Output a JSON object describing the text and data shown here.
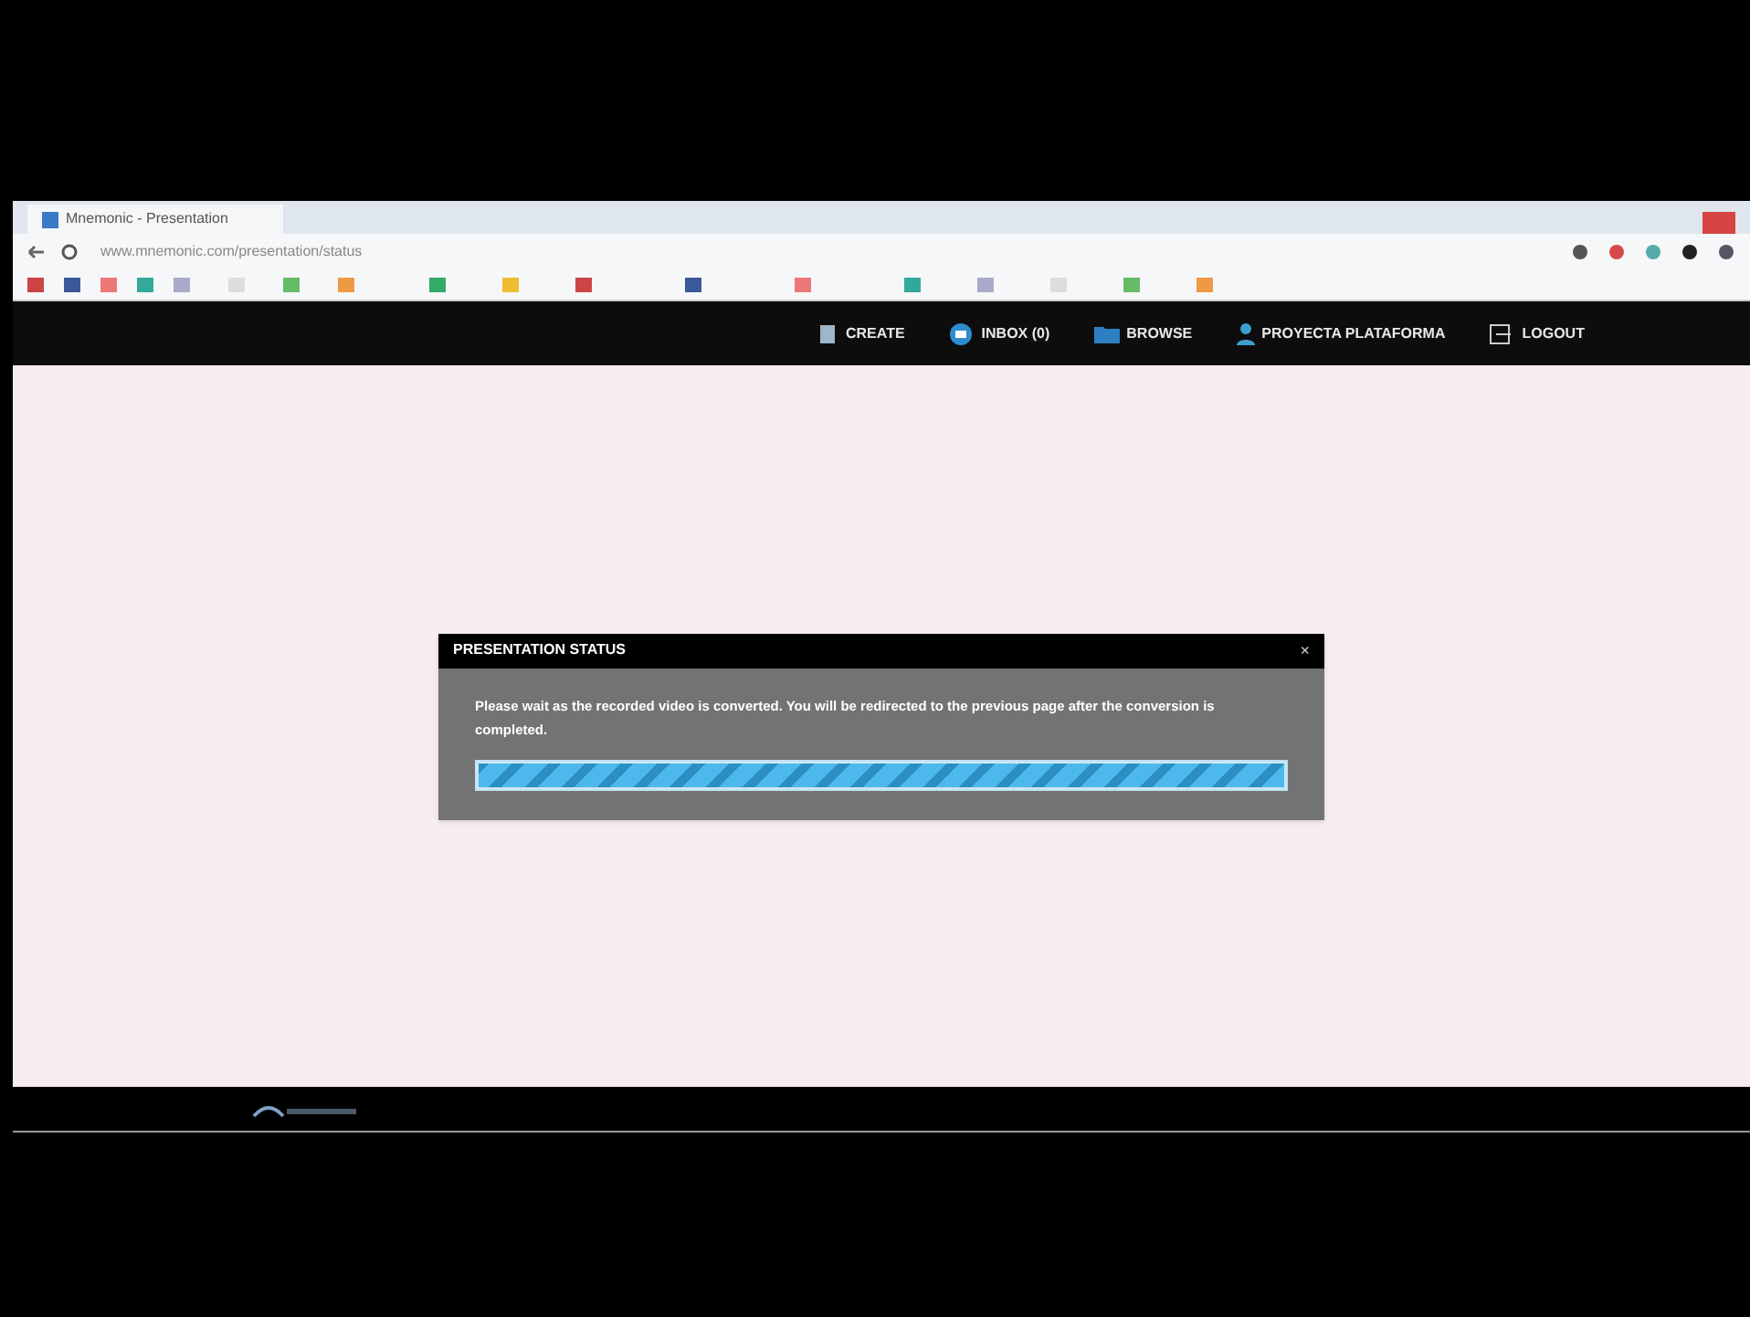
{
  "browser": {
    "tab_title": "Mnemonic - Presentation",
    "address": "www.mnemonic.com/presentation/status"
  },
  "nav": [
    {
      "kind": "create",
      "label": "CREATE"
    },
    {
      "kind": "inbox",
      "label": "INBOX (0)"
    },
    {
      "kind": "browse",
      "label": "BROWSE"
    },
    {
      "kind": "user",
      "label": "PROYECTA PLATAFORMA"
    },
    {
      "kind": "logout",
      "label": "LOGOUT"
    }
  ],
  "dialog": {
    "title": "PRESENTATION STATUS",
    "close": "×",
    "message": "Please wait as the recorded video is converted. You will be redirected to the previous page after the conversion is completed.",
    "progress": {
      "level": 1
    }
  }
}
